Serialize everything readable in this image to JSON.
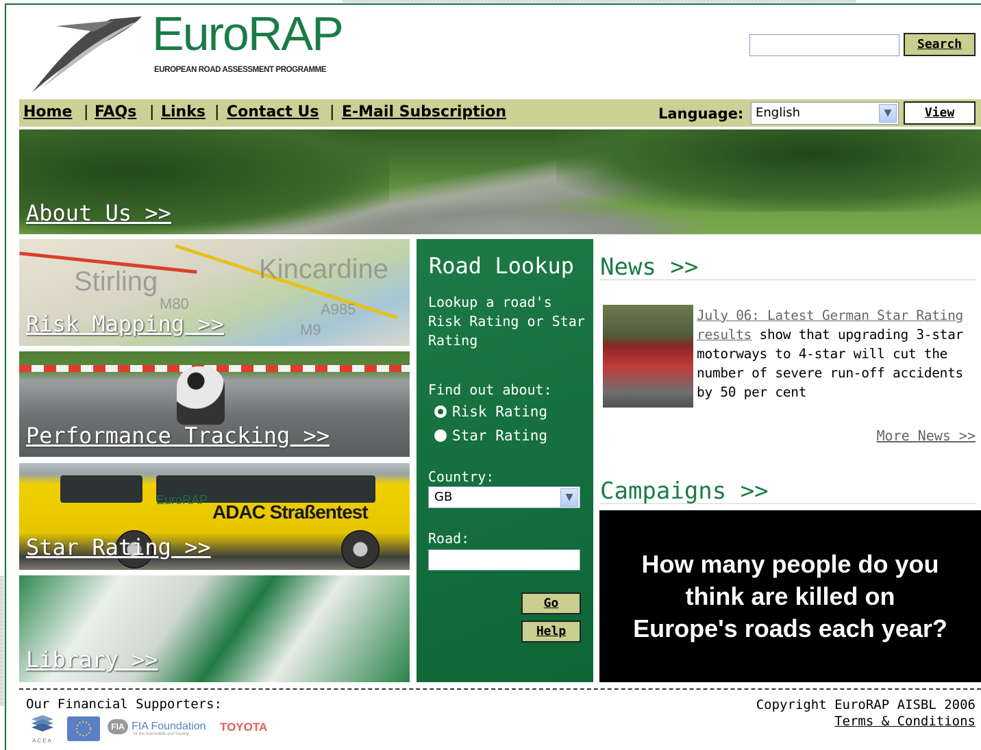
{
  "header": {
    "logo_title": "EuroRAP",
    "logo_subtitle": "EUROPEAN ROAD ASSESSMENT PROGRAMME",
    "search_value": "",
    "search_button": "Search"
  },
  "nav": {
    "items": [
      "Home",
      "FAQs",
      "Links",
      "Contact Us",
      "E-Mail Subscription"
    ],
    "separator": "|",
    "language_label": "Language:",
    "language_value": "English",
    "view_button": "View"
  },
  "hero": {
    "link": "About Us >>"
  },
  "tiles": [
    {
      "link": "Risk Mapping >>"
    },
    {
      "link": "Performance Tracking >>"
    },
    {
      "link": "Star Rating >>"
    },
    {
      "link": "Library >>"
    }
  ],
  "tile_art": {
    "map_labels": [
      "Stirling",
      "Kincardine",
      "M80",
      "A985",
      "M9"
    ],
    "van_logo": "EuroRAP",
    "van_text": "ADAC Straßentest"
  },
  "road_lookup": {
    "title": "Road Lookup",
    "description": "Lookup a road's Risk Rating or Star Rating",
    "find_out_label": "Find out about:",
    "options": [
      {
        "label": "Risk Rating",
        "selected": true
      },
      {
        "label": "Star Rating",
        "selected": false
      }
    ],
    "country_label": "Country:",
    "country_value": "GB",
    "road_label": "Road:",
    "road_value": "",
    "go_button": "Go",
    "help_button": "Help"
  },
  "news": {
    "title": "News >>",
    "item_link": "July 06: Latest German Star Rating results",
    "item_text": " show that upgrading 3-star motorways to 4-star will cut the number of severe run-off accidents by 50 per cent",
    "more": "More News >>"
  },
  "campaigns": {
    "title": "Campaigns >>",
    "banner_text": "How many people do you think are killed on Europe's roads each year?"
  },
  "footer": {
    "supporters_label": "Our Financial Supporters:",
    "supporters": [
      "ACEA",
      "FIA",
      "FIA Foundation",
      "for the Automobile and Society",
      "TOYOTA"
    ],
    "copyright": "Copyright EuroRAP AISBL 2006",
    "terms": "Terms & Conditions"
  },
  "colors": {
    "brand_green": "#1a7c45",
    "nav_olive": "#cbd094",
    "panel_green": "#16703f"
  }
}
